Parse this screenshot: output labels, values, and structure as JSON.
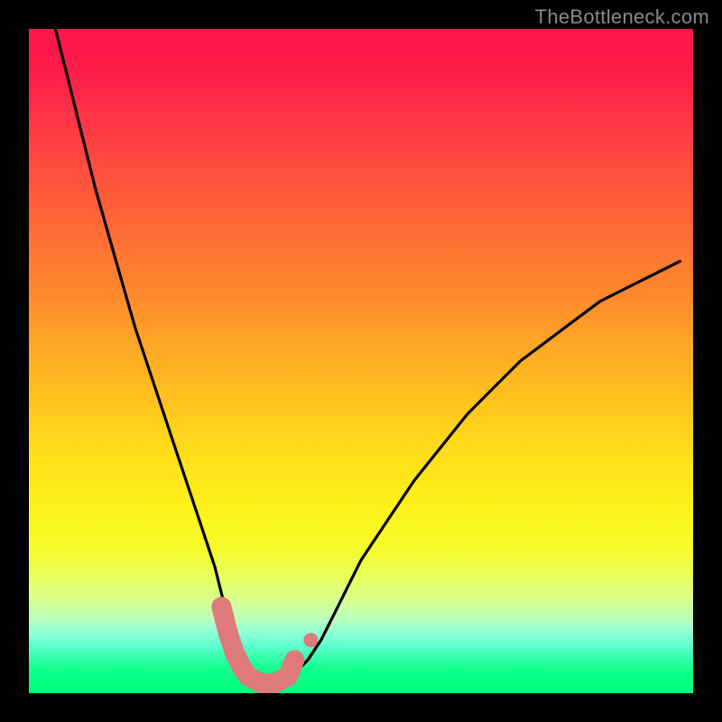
{
  "watermark": "TheBottleneck.com",
  "chart_data": {
    "type": "line",
    "title": "",
    "xlabel": "",
    "ylabel": "",
    "xlim": [
      0,
      100
    ],
    "ylim": [
      0,
      100
    ],
    "legend": false,
    "grid": false,
    "series": [
      {
        "name": "bottleneck-curve",
        "x": [
          4,
          6,
          8,
          10,
          12,
          14,
          16,
          18,
          20,
          22,
          24,
          26,
          28,
          29,
          30,
          31,
          32,
          33,
          34,
          35,
          36,
          37,
          38,
          39,
          40,
          42,
          44,
          46,
          48,
          50,
          54,
          58,
          62,
          66,
          70,
          74,
          78,
          82,
          86,
          90,
          94,
          98
        ],
        "y": [
          100,
          92,
          84,
          76,
          69,
          62,
          55,
          49,
          43,
          37,
          31,
          25,
          19,
          15,
          11,
          8,
          5,
          3,
          2,
          1,
          1,
          1,
          1,
          2,
          3,
          5,
          8,
          12,
          16,
          20,
          26,
          32,
          37,
          42,
          46,
          50,
          53,
          56,
          59,
          61,
          63,
          65
        ]
      }
    ],
    "highlight": {
      "name": "tolerance-band",
      "color": "#de7a7b",
      "x": [
        29,
        30,
        31,
        32,
        33,
        34,
        35,
        36,
        37,
        38,
        39,
        40
      ],
      "y": [
        13,
        9,
        6,
        4,
        2.5,
        2,
        1.5,
        1.5,
        1.5,
        2,
        2.5,
        5
      ]
    },
    "background_gradient": {
      "top": "#ff1749",
      "mid": "#ffe21c",
      "bottom": "#00ff7c"
    }
  }
}
